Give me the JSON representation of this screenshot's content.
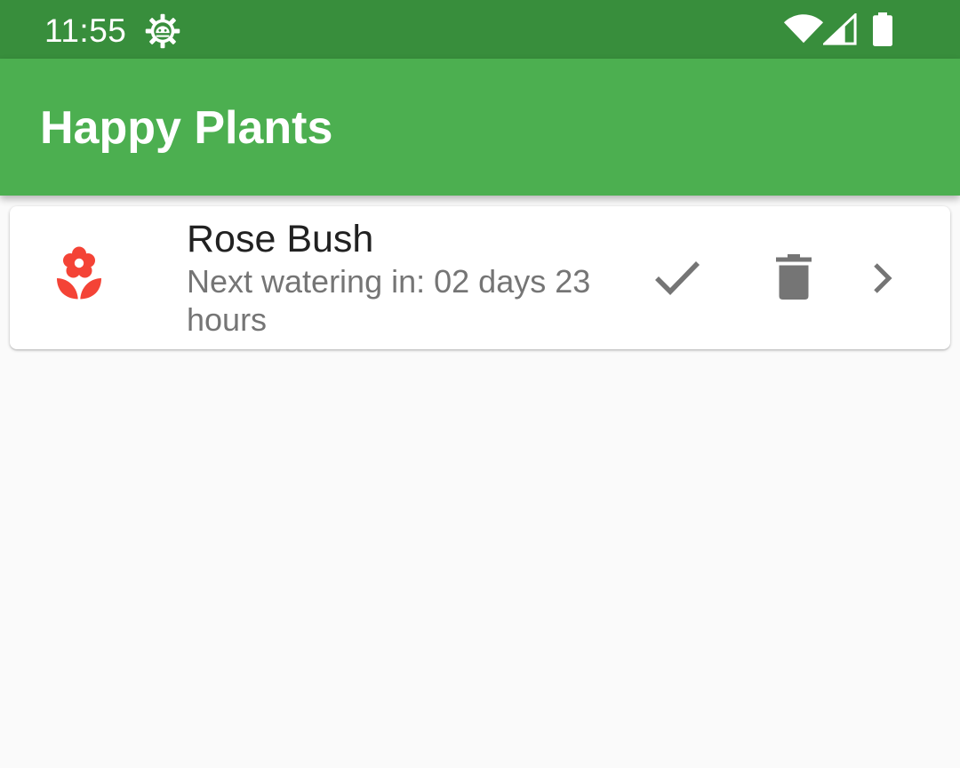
{
  "status_bar": {
    "time": "11:55",
    "icons": [
      "settings-gear-icon",
      "wifi-icon",
      "signal-icon",
      "battery-icon"
    ]
  },
  "app_bar": {
    "title": "Happy Plants"
  },
  "plants": [
    {
      "name": "Rose Bush",
      "next_watering": "Next watering in: 02 days 23 hours",
      "icon": "flower-icon",
      "actions": [
        "check-icon",
        "delete-icon",
        "chevron-right-icon"
      ]
    }
  ],
  "colors": {
    "status_bar": "#388e3c",
    "app_bar": "#4caf50",
    "background": "#fafafa",
    "card": "#ffffff",
    "flower": "#f44336",
    "action_icon": "#757575",
    "primary_text": "#212121",
    "secondary_text": "#757575"
  }
}
